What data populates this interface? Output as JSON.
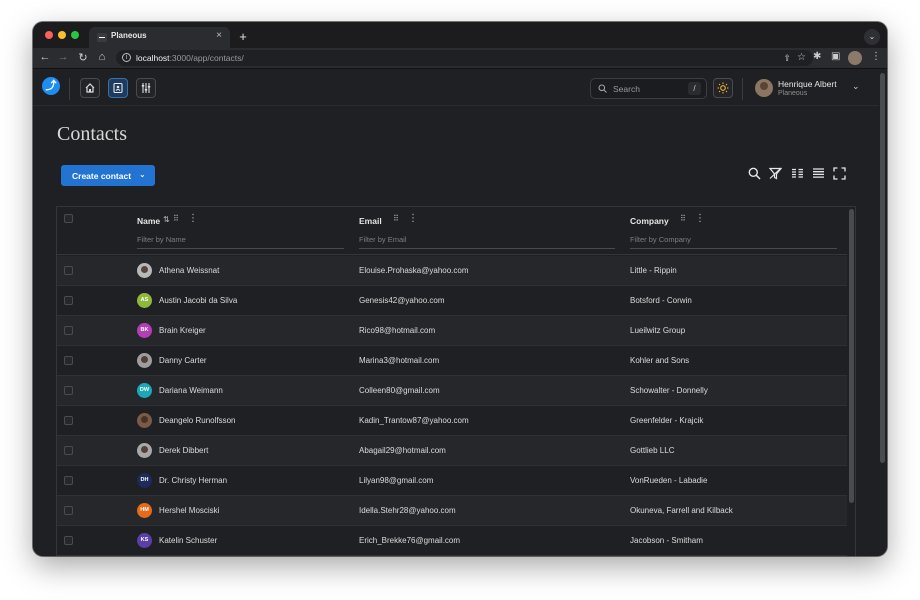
{
  "browser": {
    "tab_title": "Planeous",
    "tab_close": "×",
    "new_tab": "+",
    "url_host": "localhost",
    "url_path": ":3000/app/contacts/"
  },
  "app": {
    "search_placeholder": "Search",
    "search_shortcut": "/",
    "user_name": "Henrique Albert",
    "user_org": "Planeous",
    "page_title": "Contacts",
    "create_button": "Create contact"
  },
  "colors": {
    "accent": "#2374d2",
    "background": "#1f2023",
    "logo": "#1f8cf0"
  },
  "table": {
    "columns": [
      {
        "label": "Name",
        "filter_placeholder": "Filter by Name"
      },
      {
        "label": "Email",
        "filter_placeholder": "Filter by Email"
      },
      {
        "label": "Company",
        "filter_placeholder": "Filter by Company"
      }
    ],
    "rows": [
      {
        "name": "Athena Weissnat",
        "email": "Elouise.Prohaska@yahoo.com",
        "company": "Little - Rippin",
        "initials": "",
        "avatar_color": "#b8b8b8"
      },
      {
        "name": "Austin Jacobi da Silva",
        "email": "Genesis42@yahoo.com",
        "company": "Botsford - Corwin",
        "initials": "AS",
        "avatar_color": "#8db83a"
      },
      {
        "name": "Brain Kreiger",
        "email": "Rico98@hotmail.com",
        "company": "Lueilwitz Group",
        "initials": "BK",
        "avatar_color": "#b43fb4"
      },
      {
        "name": "Danny Carter",
        "email": "Marina3@hotmail.com",
        "company": "Kohler and Sons",
        "initials": "",
        "avatar_color": "#9e9e9e"
      },
      {
        "name": "Dariana Weimann",
        "email": "Colleen80@gmail.com",
        "company": "Schowalter - Donnelly",
        "initials": "DW",
        "avatar_color": "#1ba9b8"
      },
      {
        "name": "Deangelo Runolfsson",
        "email": "Kadin_Trantow87@yahoo.com",
        "company": "Greenfelder - Krajcik",
        "initials": "",
        "avatar_color": "#7a5a48"
      },
      {
        "name": "Derek Dibbert",
        "email": "Abagail29@hotmail.com",
        "company": "Gottlieb LLC",
        "initials": "",
        "avatar_color": "#a8a8a8"
      },
      {
        "name": "Dr. Christy Herman",
        "email": "Lilyan98@gmail.com",
        "company": "VonRueden - Labadie",
        "initials": "DH",
        "avatar_color": "#1d2a5a"
      },
      {
        "name": "Hershel Mosciski",
        "email": "Idella.Stehr28@yahoo.com",
        "company": "Okuneva, Farrell and Kilback",
        "initials": "HM",
        "avatar_color": "#e46a1c"
      },
      {
        "name": "Katelin Schuster",
        "email": "Erich_Brekke76@gmail.com",
        "company": "Jacobson - Smitham",
        "initials": "KS",
        "avatar_color": "#5a3fa8"
      }
    ]
  }
}
